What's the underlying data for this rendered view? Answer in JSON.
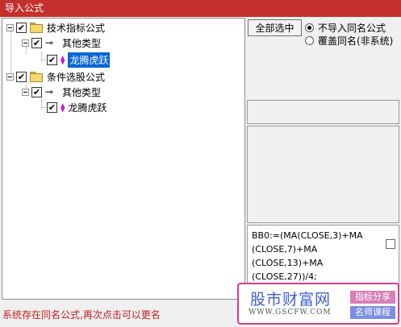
{
  "window": {
    "title": "导入公式"
  },
  "tree": {
    "group1": {
      "label": "技术指标公式",
      "sub": {
        "label": "其他类型",
        "item": {
          "label": "龙腾虎跃"
        }
      }
    },
    "group2": {
      "label": "条件选股公式",
      "sub": {
        "label": "其他类型",
        "item": {
          "label": "龙腾虎跃"
        }
      }
    }
  },
  "actions": {
    "select_all_label": "全部选中",
    "radio_skip_label": "不导入同名公式",
    "radio_overwrite_label": "覆盖同名(非系统)"
  },
  "formula": {
    "line1": "BB0:=(MA(CLOSE,3)+MA",
    "line2": "(CLOSE,7)+MA",
    "line3": "(CLOSE,13)+MA",
    "line4": "(CLOSE,27))/4;"
  },
  "status": {
    "message": "系统存在同名公式,再次点击可以更名"
  },
  "watermark": {
    "title": "股市财富网",
    "url": "WWW.GSCFW.COM",
    "tag1": "指标分享",
    "tag2": "名师课程"
  }
}
